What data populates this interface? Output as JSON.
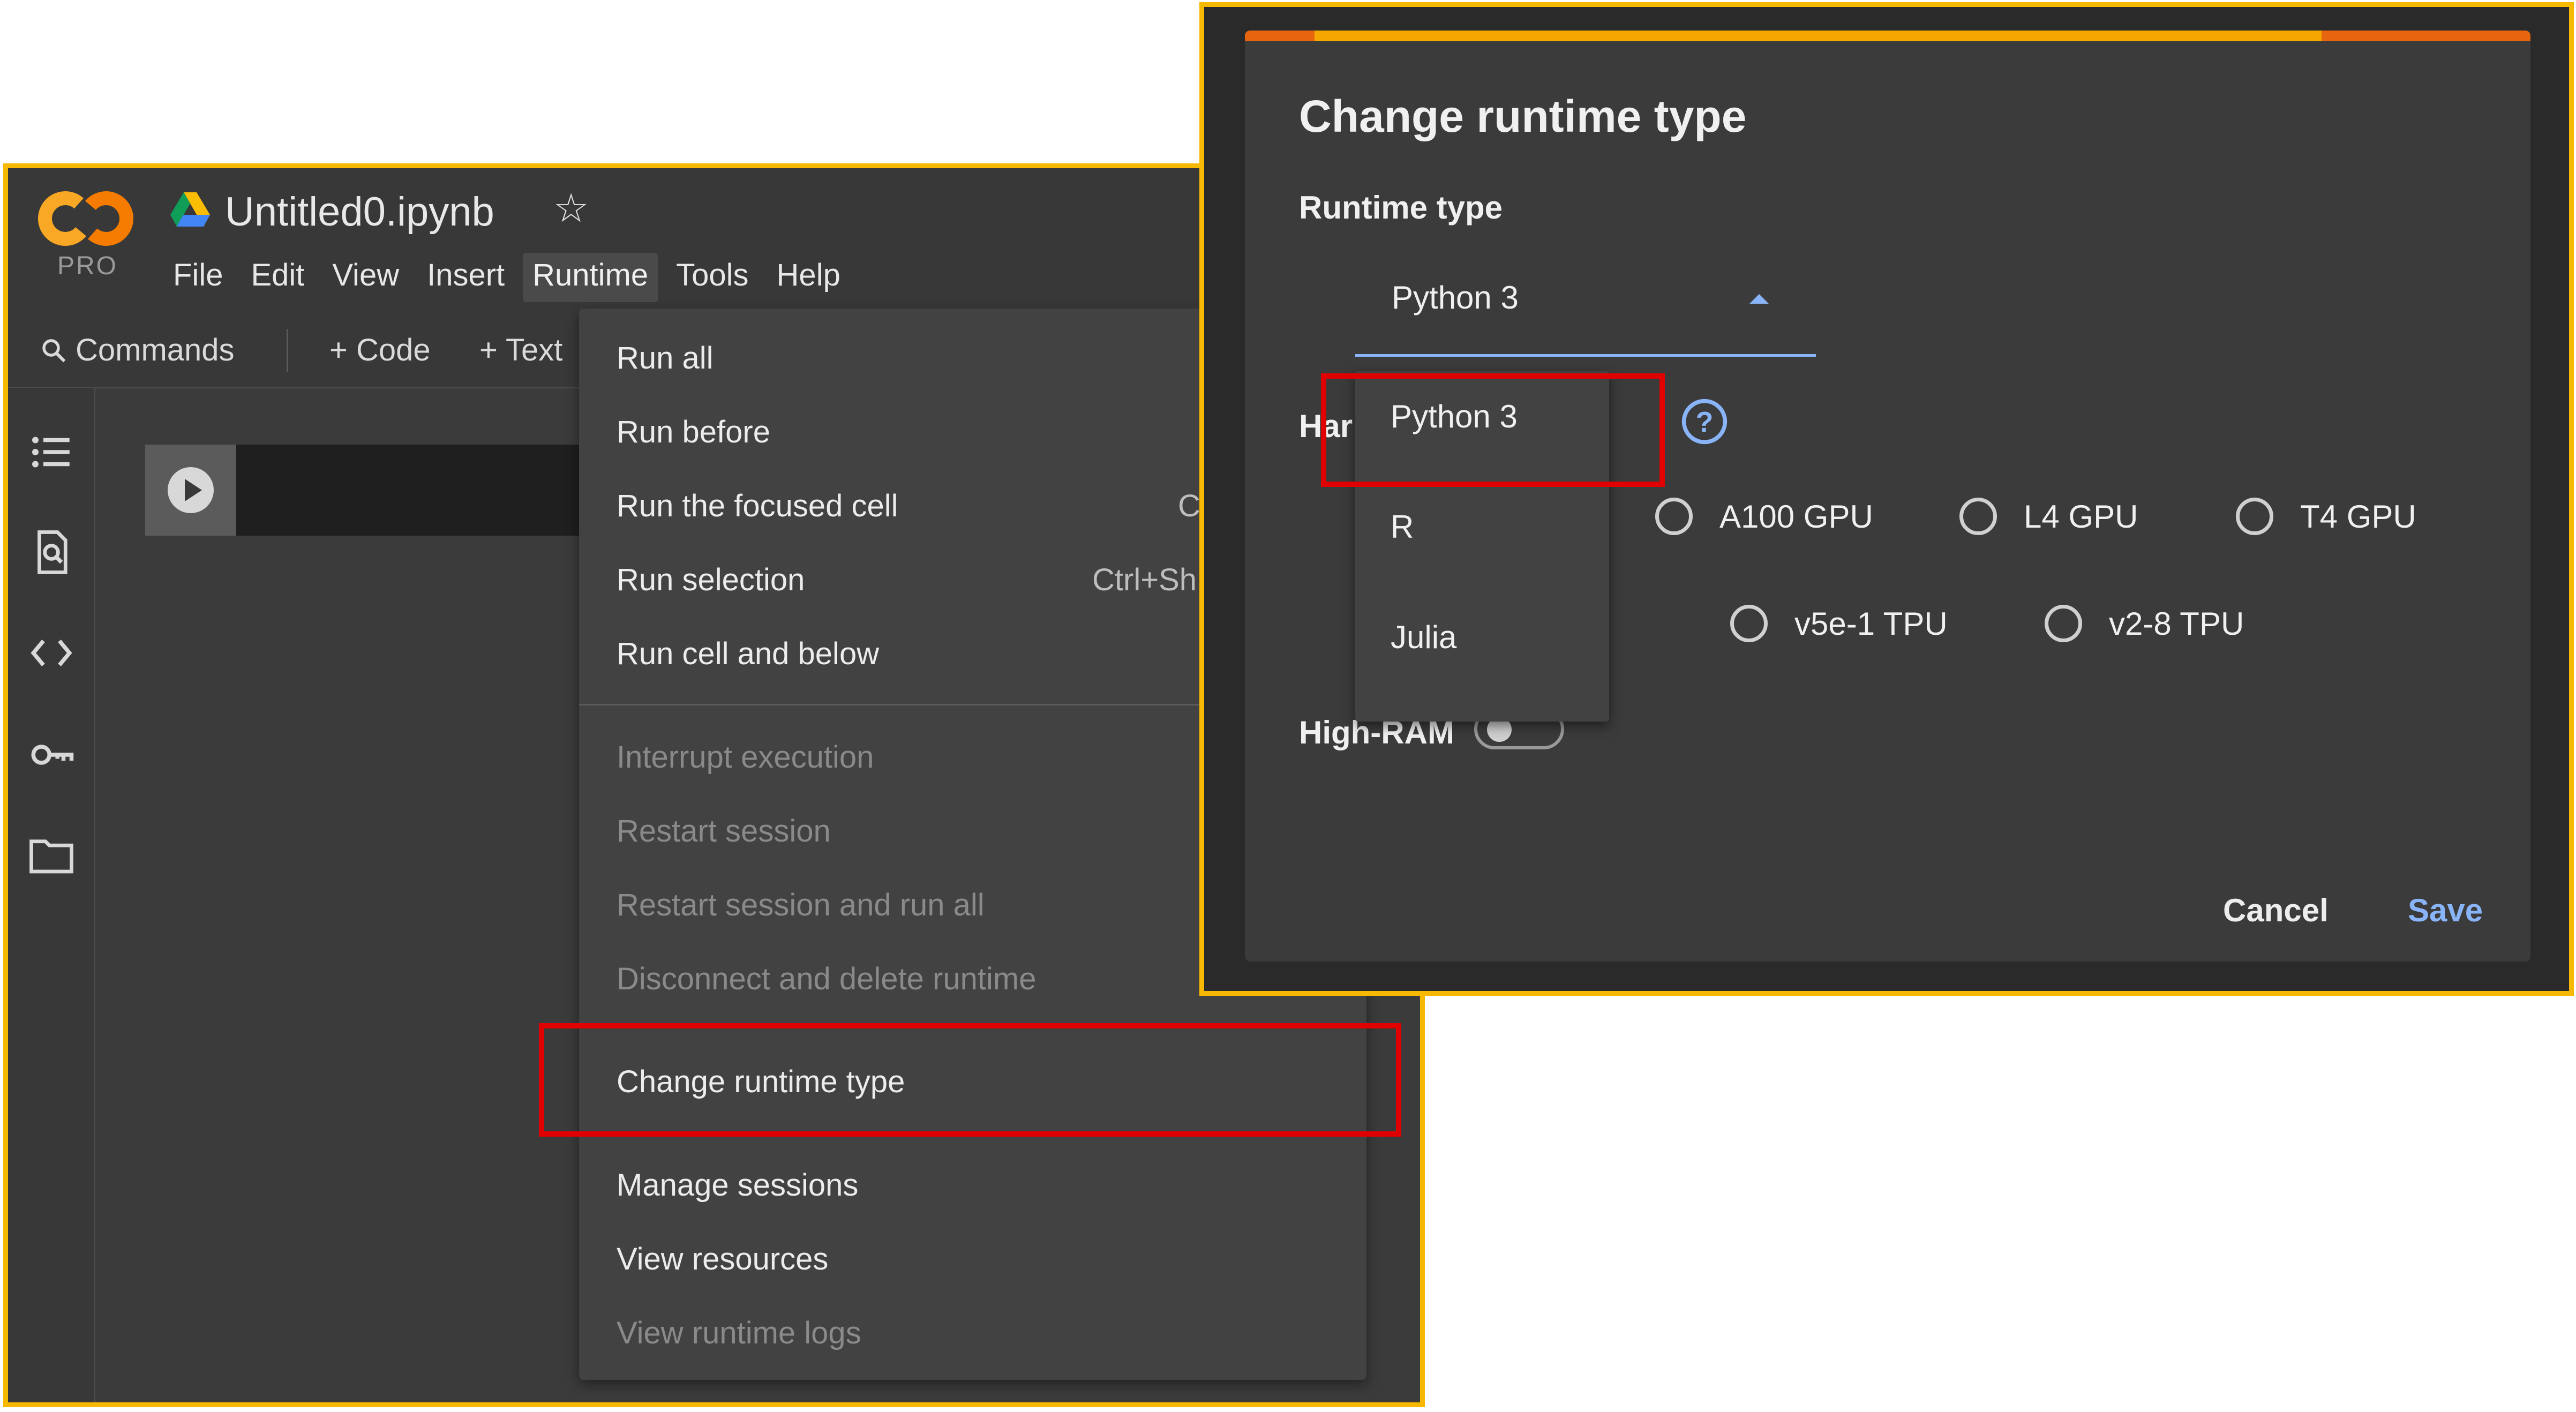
{
  "colab": {
    "logo_text": "CO",
    "plan_badge": "PRO",
    "doc_title": "Untitled0.ipynb",
    "menu": [
      "File",
      "Edit",
      "View",
      "Insert",
      "Runtime",
      "Tools",
      "Help"
    ],
    "active_menu": "Runtime",
    "toolbar": {
      "commands": "Commands",
      "code": "+ Code",
      "text": "+ Text"
    },
    "left_icons": [
      "table-of-contents-icon",
      "find-icon",
      "code-snippets-icon",
      "secrets-key-icon",
      "files-folder-icon"
    ]
  },
  "runtime_menu": {
    "items": [
      {
        "label": "Run all",
        "enabled": true
      },
      {
        "label": "Run before",
        "enabled": true
      },
      {
        "label": "Run the focused cell",
        "shortcut": "C",
        "enabled": true
      },
      {
        "label": "Run selection",
        "shortcut": "Ctrl+Sh",
        "enabled": true
      },
      {
        "label": "Run cell and below",
        "enabled": true
      },
      {
        "label": "Interrupt execution",
        "enabled": false
      },
      {
        "label": "Restart session",
        "enabled": false
      },
      {
        "label": "Restart session and run all",
        "enabled": false
      },
      {
        "label": "Disconnect and delete runtime",
        "enabled": false
      },
      {
        "label": "Change runtime type",
        "enabled": true,
        "highlighted": true
      },
      {
        "label": "Manage sessions",
        "enabled": true
      },
      {
        "label": "View resources",
        "enabled": true
      },
      {
        "label": "View runtime logs",
        "enabled": false
      }
    ]
  },
  "dialog": {
    "title": "Change runtime type",
    "runtime_type_label": "Runtime type",
    "selected_runtime": "Python 3",
    "hardware_label_partial": "Har",
    "high_ram_label": "High-RAM",
    "dropdown_options": [
      "Python 3",
      "R",
      "Julia"
    ],
    "hardware_options_row1": [
      "A100 GPU",
      "L4 GPU",
      "T4 GPU"
    ],
    "hardware_options_row2": [
      "v5e-1 TPU",
      "v2-8 TPU"
    ],
    "cancel": "Cancel",
    "save": "Save"
  },
  "colors": {
    "frame_border": "#f7b800",
    "highlight": "#e00000",
    "accent_blue": "#8ab4f8",
    "progress": "#f3a700"
  }
}
